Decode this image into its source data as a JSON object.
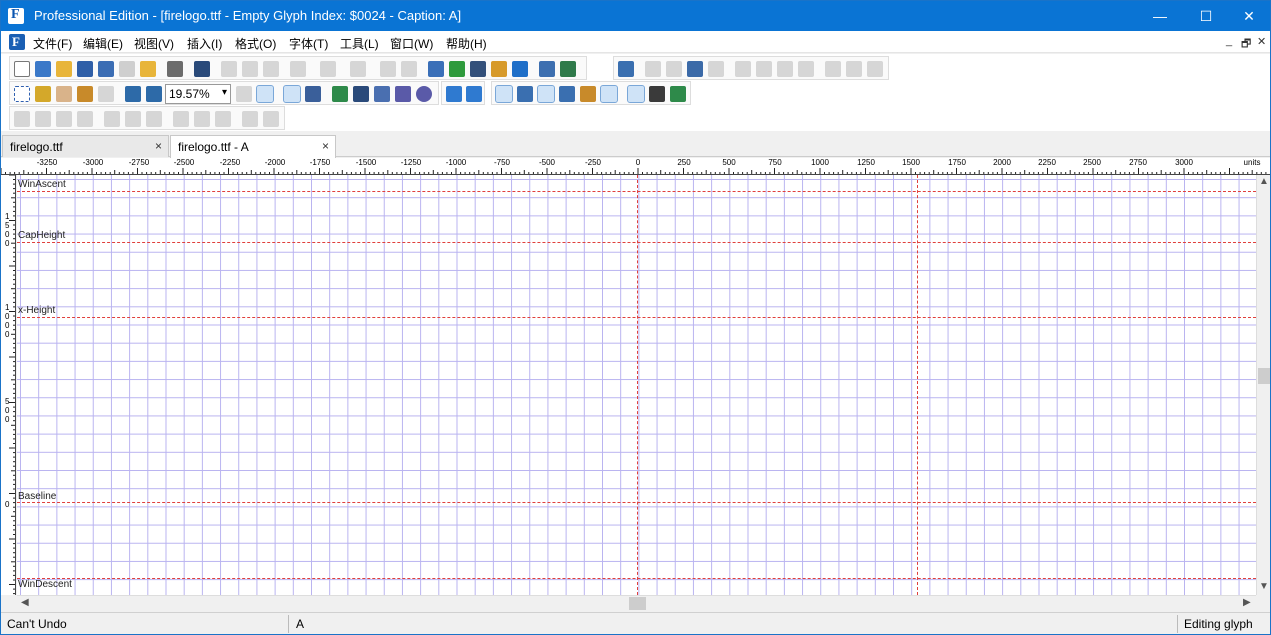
{
  "window": {
    "title": "Professional Edition - [firelogo.ttf - Empty Glyph Index: $0024 - Caption: A]",
    "controls": {
      "minimize": "—",
      "maximize": "☐",
      "close": "✕"
    }
  },
  "menu": {
    "items": [
      "文件(F)",
      "编辑(E)",
      "视图(V)",
      "插入(I)",
      "格式(O)",
      "字体(T)",
      "工具(L)",
      "窗口(W)",
      "帮助(H)"
    ],
    "mdi": {
      "minimize": "_",
      "restore": "🗗",
      "close": "✕"
    }
  },
  "toolbar": {
    "zoom_value": "19.57%"
  },
  "tabs": [
    {
      "label": "firelogo.ttf",
      "close": "×"
    },
    {
      "label": "firelogo.ttf - A",
      "close": "×"
    }
  ],
  "ruler": {
    "labels": [
      "-3250",
      "-3000",
      "-2750",
      "-2500",
      "-2250",
      "-2000",
      "-1750",
      "-1500",
      "-1250",
      "-1000",
      "-750",
      "-500",
      "-250",
      "0",
      "250",
      "500",
      "750",
      "1000",
      "1250",
      "1500",
      "1750",
      "2000",
      "2250",
      "2500",
      "2750",
      "3000"
    ],
    "units": "units",
    "vertical": [
      "1500",
      "1000",
      "500",
      "0"
    ]
  },
  "metrics": {
    "winascent": "WinAscent",
    "capheight": "CapHeight",
    "xheight": "x-Height",
    "baseline": "Baseline",
    "windescent": "WinDescent"
  },
  "status": {
    "undo": "Can't Undo",
    "glyph": "A",
    "mode": "Editing glyph"
  },
  "colors": {
    "titlebar": "#0a74d4",
    "grid": "#b9b3f0",
    "guide": "#e0403c"
  }
}
